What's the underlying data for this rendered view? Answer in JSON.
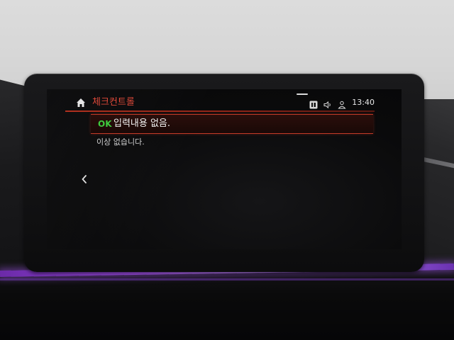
{
  "header": {
    "title": "체크컨트롤",
    "time": "13:40"
  },
  "status_icons": [
    "media-source-icon",
    "volume-icon",
    "user-profile-icon"
  ],
  "message": {
    "status_badge": "OK",
    "text": "입력내용 없음.",
    "detail": "이상 없습니다."
  },
  "colors": {
    "accent": "#e04a3a",
    "ok": "#3ecb3e",
    "ambient": "#9a4be0"
  }
}
